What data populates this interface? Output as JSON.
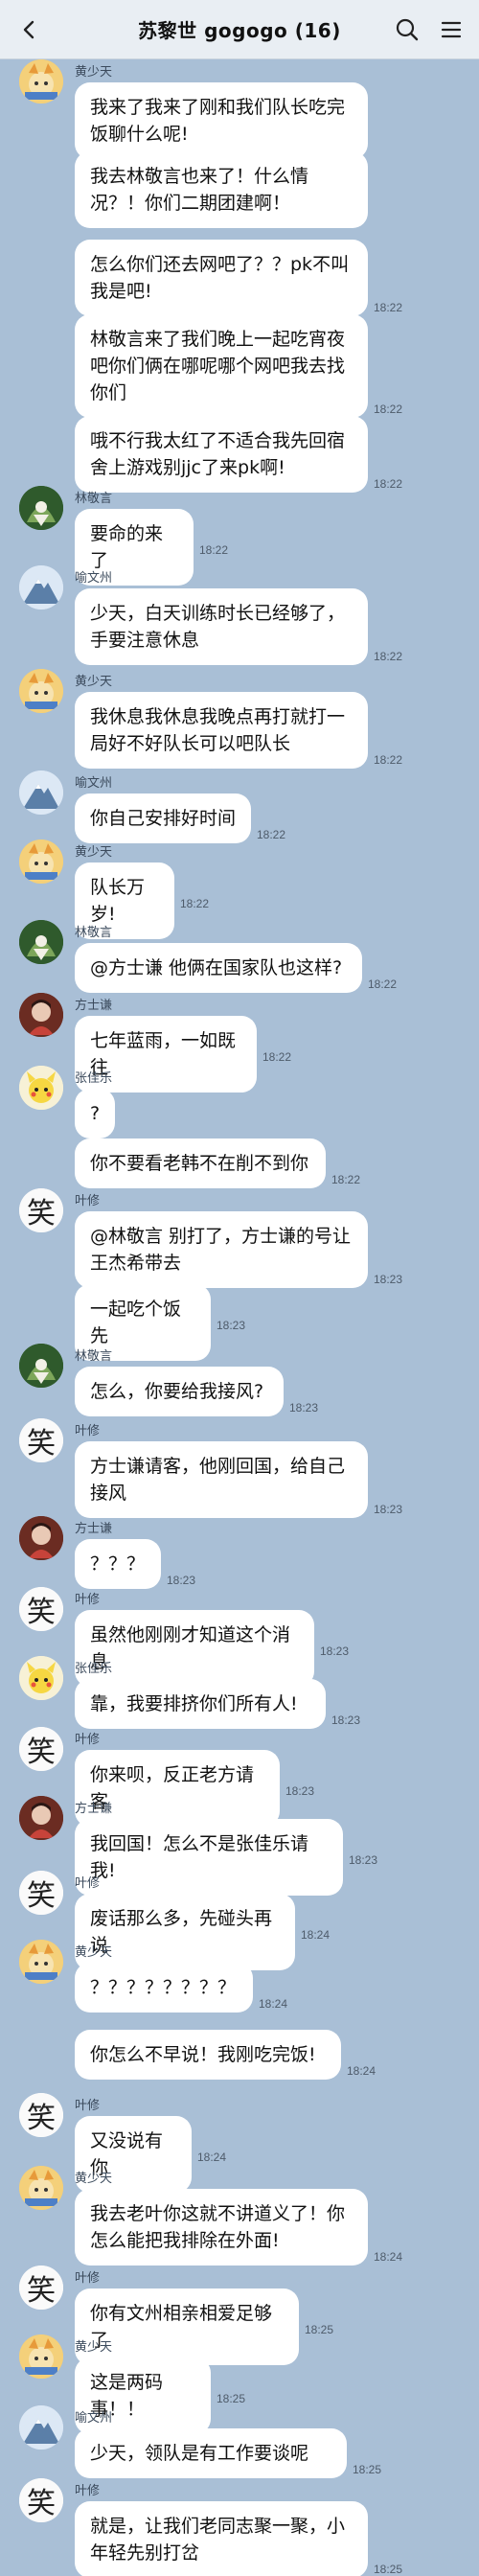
{
  "header": {
    "title": "苏黎世 gogogo (16)"
  },
  "messages": [
    {
      "avatar": "huang",
      "sender": "黄少天",
      "lines": [
        "我来了我来了刚和我们队长吃完",
        "饭聊什么呢!"
      ],
      "time": ""
    },
    {
      "avatar": "",
      "sender": "",
      "lines": [
        "我去林敬言也来了！什么情",
        "况？！你们二期团建啊！"
      ],
      "time": ""
    },
    {
      "avatar": "",
      "sender": "",
      "lines": [
        "怎么你们还去网吧了？？pk不叫",
        "我是吧!"
      ],
      "time": "18:22"
    },
    {
      "avatar": "",
      "sender": "",
      "lines": [
        "林敬言来了我们晚上一起吃宵夜",
        "吧你们俩在哪呢哪个网吧我去找",
        "你们"
      ],
      "time": "18:22"
    },
    {
      "avatar": "",
      "sender": "",
      "lines": [
        "哦不行我太红了不适合我先回宿",
        "舍上游戏别jjc了来pk啊!"
      ],
      "time": "18:22"
    },
    {
      "avatar": "lin",
      "sender": "林敬言",
      "lines": [
        "要命的来了"
      ],
      "time": "18:22"
    },
    {
      "avatar": "yu",
      "sender": "喻文州",
      "lines": [
        "少天，白天训练时长已经够了，",
        "手要注意休息"
      ],
      "time": "18:22"
    },
    {
      "avatar": "huang",
      "sender": "黄少天",
      "lines": [
        "我休息我休息我晚点再打就打一",
        "局好不好队长可以吧队长"
      ],
      "time": "18:22"
    },
    {
      "avatar": "yu",
      "sender": "喻文州",
      "lines": [
        "你自己安排好时间"
      ],
      "time": "18:22"
    },
    {
      "avatar": "huang",
      "sender": "黄少天",
      "lines": [
        "队长万岁!"
      ],
      "time": "18:22"
    },
    {
      "avatar": "lin",
      "sender": "林敬言",
      "lines": [
        "@方士谦 他俩在国家队也这样?"
      ],
      "time": "18:22"
    },
    {
      "avatar": "fang",
      "sender": "方士谦",
      "lines": [
        "七年蓝雨，一如既往"
      ],
      "time": "18:22"
    },
    {
      "avatar": "zhang",
      "sender": "张佳乐",
      "lines": [
        "?"
      ],
      "time": ""
    },
    {
      "avatar": "",
      "sender": "",
      "lines": [
        "你不要看老韩不在削不到你"
      ],
      "time": "18:22"
    },
    {
      "avatar": "ye",
      "sender": "叶修",
      "lines": [
        "@林敬言  别打了，方士谦的号让",
        "王杰希带去"
      ],
      "time": "18:23"
    },
    {
      "avatar": "",
      "sender": "",
      "lines": [
        "一起吃个饭先"
      ],
      "time": "18:23"
    },
    {
      "avatar": "lin",
      "sender": "林敬言",
      "lines": [
        "怎么，你要给我接风?"
      ],
      "time": "18:23"
    },
    {
      "avatar": "ye",
      "sender": "叶修",
      "lines": [
        "方士谦请客，他刚回国，给自己",
        "接风"
      ],
      "time": "18:23"
    },
    {
      "avatar": "fang",
      "sender": "方士谦",
      "lines": [
        "？？？"
      ],
      "time": "18:23"
    },
    {
      "avatar": "ye",
      "sender": "叶修",
      "lines": [
        "虽然他刚刚才知道这个消息"
      ],
      "time": "18:23"
    },
    {
      "avatar": "zhang",
      "sender": "张佳乐",
      "lines": [
        "靠，我要排挤你们所有人!"
      ],
      "time": "18:23"
    },
    {
      "avatar": "ye",
      "sender": "叶修",
      "lines": [
        "你来呗，反正老方请客"
      ],
      "time": "18:23"
    },
    {
      "avatar": "fang",
      "sender": "方士谦",
      "lines": [
        "我回国！怎么不是张佳乐请我!"
      ],
      "time": "18:23"
    },
    {
      "avatar": "ye",
      "sender": "叶修",
      "lines": [
        "废话那么多，先碰头再说"
      ],
      "time": "18:24"
    },
    {
      "avatar": "huang",
      "sender": "黄少天",
      "lines": [
        "？？？？？？？？"
      ],
      "time": "18:24"
    },
    {
      "avatar": "",
      "sender": "",
      "lines": [
        "你怎么不早说！我刚吃完饭!"
      ],
      "time": "18:24"
    },
    {
      "avatar": "ye",
      "sender": "叶修",
      "lines": [
        "又没说有你"
      ],
      "time": "18:24"
    },
    {
      "avatar": "huang",
      "sender": "黄少天",
      "lines": [
        "我去老叶你这就不讲道义了！你",
        "怎么能把我排除在外面!"
      ],
      "time": "18:24"
    },
    {
      "avatar": "ye",
      "sender": "叶修",
      "lines": [
        "你有文州相亲相爱足够了"
      ],
      "time": "18:25"
    },
    {
      "avatar": "huang",
      "sender": "黄少天",
      "lines": [
        "这是两码事！！"
      ],
      "time": "18:25"
    },
    {
      "avatar": "yu",
      "sender": "喻文州",
      "lines": [
        "少天，领队是有工作要谈呢"
      ],
      "time": "18:25"
    },
    {
      "avatar": "ye",
      "sender": "叶修",
      "lines": [
        "就是，让我们老同志聚一聚，小",
        "年轻先别打岔"
      ],
      "time": "18:25"
    }
  ],
  "avatar_glyph_ye": "笑"
}
